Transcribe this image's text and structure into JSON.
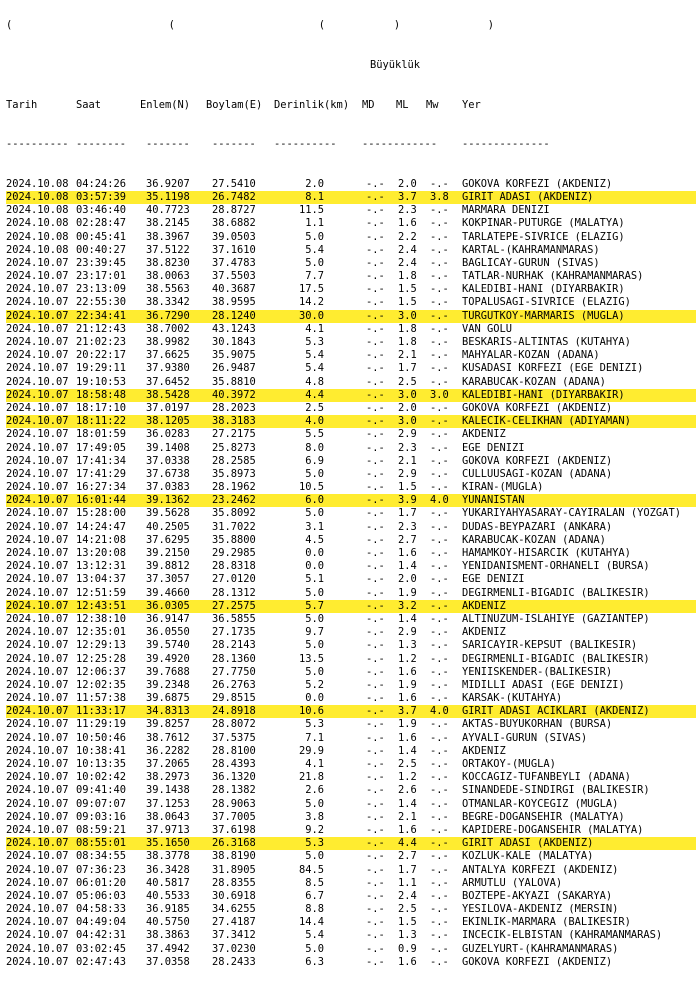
{
  "top_fragment": "(                         (                       (           )              )",
  "header": {
    "group_label": "Büyüklük",
    "columns": [
      "Tarih",
      "Saat",
      "Enlem(N)",
      "Boylam(E)",
      "Derinlik(km)",
      "MD",
      "ML",
      "Mw",
      "Yer"
    ]
  },
  "separator": [
    "----------",
    "--------",
    "-------",
    "-------",
    "----------",
    "------------",
    "--------------"
  ],
  "highlight_color": "#ffec30",
  "rows": [
    {
      "date": "2024.10.08",
      "time": "04:24:26",
      "lat": "36.9207",
      "lon": "27.5410",
      "depth": "2.0",
      "md": "-.-",
      "ml": "2.0",
      "mw": "-.-",
      "place": "GOKOVA KORFEZI (AKDENIZ)",
      "hl": false
    },
    {
      "date": "2024.10.08",
      "time": "03:57:39",
      "lat": "35.1198",
      "lon": "26.7482",
      "depth": "8.1",
      "md": "-.-",
      "ml": "3.7",
      "mw": "3.8",
      "place": "GIRIT ADASI (AKDENIZ)",
      "hl": true
    },
    {
      "date": "2024.10.08",
      "time": "03:46:40",
      "lat": "40.7723",
      "lon": "28.8727",
      "depth": "11.5",
      "md": "-.-",
      "ml": "2.3",
      "mw": "-.-",
      "place": "MARMARA DENIZI",
      "hl": false
    },
    {
      "date": "2024.10.08",
      "time": "02:28:47",
      "lat": "38.2145",
      "lon": "38.6882",
      "depth": "1.1",
      "md": "-.-",
      "ml": "1.6",
      "mw": "-.-",
      "place": "KOKPINAR-PUTURGE (MALATYA)",
      "hl": false
    },
    {
      "date": "2024.10.08",
      "time": "00:45:41",
      "lat": "38.3967",
      "lon": "39.0503",
      "depth": "5.0",
      "md": "-.-",
      "ml": "2.2",
      "mw": "-.-",
      "place": "TARLATEPE-SIVRICE (ELAZIG)",
      "hl": false
    },
    {
      "date": "2024.10.08",
      "time": "00:40:27",
      "lat": "37.5122",
      "lon": "37.1610",
      "depth": "5.4",
      "md": "-.-",
      "ml": "2.4",
      "mw": "-.-",
      "place": "KARTAL-(KAHRAMANMARAS)",
      "hl": false
    },
    {
      "date": "2024.10.07",
      "time": "23:39:45",
      "lat": "38.8230",
      "lon": "37.4783",
      "depth": "5.0",
      "md": "-.-",
      "ml": "2.4",
      "mw": "-.-",
      "place": "BAGLICAY-GURUN (SIVAS)",
      "hl": false
    },
    {
      "date": "2024.10.07",
      "time": "23:17:01",
      "lat": "38.0063",
      "lon": "37.5503",
      "depth": "7.7",
      "md": "-.-",
      "ml": "1.8",
      "mw": "-.-",
      "place": "TATLAR-NURHAK (KAHRAMANMARAS)",
      "hl": false
    },
    {
      "date": "2024.10.07",
      "time": "23:13:09",
      "lat": "38.5563",
      "lon": "40.3687",
      "depth": "17.5",
      "md": "-.-",
      "ml": "1.5",
      "mw": "-.-",
      "place": "KALEDIBI-HANI (DIYARBAKIR)",
      "hl": false
    },
    {
      "date": "2024.10.07",
      "time": "22:55:30",
      "lat": "38.3342",
      "lon": "38.9595",
      "depth": "14.2",
      "md": "-.-",
      "ml": "1.5",
      "mw": "-.-",
      "place": "TOPALUSAGI-SIVRICE (ELAZIG)",
      "hl": false
    },
    {
      "date": "2024.10.07",
      "time": "22:34:41",
      "lat": "36.7290",
      "lon": "28.1240",
      "depth": "30.0",
      "md": "-.-",
      "ml": "3.0",
      "mw": "-.-",
      "place": "TURGUTKOY-MARMARIS (MUGLA)",
      "hl": true
    },
    {
      "date": "2024.10.07",
      "time": "21:12:43",
      "lat": "38.7002",
      "lon": "43.1243",
      "depth": "4.1",
      "md": "-.-",
      "ml": "1.8",
      "mw": "-.-",
      "place": "VAN GOLU",
      "hl": false
    },
    {
      "date": "2024.10.07",
      "time": "21:02:23",
      "lat": "38.9982",
      "lon": "30.1843",
      "depth": "5.3",
      "md": "-.-",
      "ml": "1.8",
      "mw": "-.-",
      "place": "BESKARIS-ALTINTAS (KUTAHYA)",
      "hl": false
    },
    {
      "date": "2024.10.07",
      "time": "20:22:17",
      "lat": "37.6625",
      "lon": "35.9075",
      "depth": "5.4",
      "md": "-.-",
      "ml": "2.1",
      "mw": "-.-",
      "place": "MAHYALAR-KOZAN (ADANA)",
      "hl": false
    },
    {
      "date": "2024.10.07",
      "time": "19:29:11",
      "lat": "37.9380",
      "lon": "26.9487",
      "depth": "5.4",
      "md": "-.-",
      "ml": "1.7",
      "mw": "-.-",
      "place": "KUSADASI KORFEZI (EGE DENIZI)",
      "hl": false
    },
    {
      "date": "2024.10.07",
      "time": "19:10:53",
      "lat": "37.6452",
      "lon": "35.8810",
      "depth": "4.8",
      "md": "-.-",
      "ml": "2.5",
      "mw": "-.-",
      "place": "KARABUCAK-KOZAN (ADANA)",
      "hl": false
    },
    {
      "date": "2024.10.07",
      "time": "18:58:48",
      "lat": "38.5428",
      "lon": "40.3972",
      "depth": "4.4",
      "md": "-.-",
      "ml": "3.0",
      "mw": "3.0",
      "place": "KALEDIBI-HANI (DIYARBAKIR)",
      "hl": true
    },
    {
      "date": "2024.10.07",
      "time": "18:17:10",
      "lat": "37.0197",
      "lon": "28.2023",
      "depth": "2.5",
      "md": "-.-",
      "ml": "2.0",
      "mw": "-.-",
      "place": "GOKOVA KORFEZI (AKDENIZ)",
      "hl": false
    },
    {
      "date": "2024.10.07",
      "time": "18:11:22",
      "lat": "38.1205",
      "lon": "38.3183",
      "depth": "4.0",
      "md": "-.-",
      "ml": "3.0",
      "mw": "-.-",
      "place": "KALECIK-CELIKHAN (ADIYAMAN)",
      "hl": true
    },
    {
      "date": "2024.10.07",
      "time": "18:01:59",
      "lat": "36.0283",
      "lon": "27.2175",
      "depth": "5.5",
      "md": "-.-",
      "ml": "2.9",
      "mw": "-.-",
      "place": "AKDENIZ",
      "hl": false
    },
    {
      "date": "2024.10.07",
      "time": "17:49:05",
      "lat": "39.1408",
      "lon": "25.8273",
      "depth": "8.0",
      "md": "-.-",
      "ml": "2.3",
      "mw": "-.-",
      "place": "EGE DENIZI",
      "hl": false
    },
    {
      "date": "2024.10.07",
      "time": "17:41:34",
      "lat": "37.0338",
      "lon": "28.2585",
      "depth": "6.9",
      "md": "-.-",
      "ml": "2.1",
      "mw": "-.-",
      "place": "GOKOVA KORFEZI (AKDENIZ)",
      "hl": false
    },
    {
      "date": "2024.10.07",
      "time": "17:41:29",
      "lat": "37.6738",
      "lon": "35.8973",
      "depth": "5.0",
      "md": "-.-",
      "ml": "2.9",
      "mw": "-.-",
      "place": "CULLUUSAGI-KOZAN (ADANA)",
      "hl": false
    },
    {
      "date": "2024.10.07",
      "time": "16:27:34",
      "lat": "37.0383",
      "lon": "28.1962",
      "depth": "10.5",
      "md": "-.-",
      "ml": "1.5",
      "mw": "-.-",
      "place": "KIRAN-(MUGLA)",
      "hl": false
    },
    {
      "date": "2024.10.07",
      "time": "16:01:44",
      "lat": "39.1362",
      "lon": "23.2462",
      "depth": "6.0",
      "md": "-.-",
      "ml": "3.9",
      "mw": "4.0",
      "place": "YUNANISTAN",
      "hl": true
    },
    {
      "date": "2024.10.07",
      "time": "15:28:00",
      "lat": "39.5628",
      "lon": "35.8092",
      "depth": "5.0",
      "md": "-.-",
      "ml": "1.7",
      "mw": "-.-",
      "place": "YUKARIYAHYASARAY-CAYIRALAN (YOZGAT)",
      "hl": false
    },
    {
      "date": "2024.10.07",
      "time": "14:24:47",
      "lat": "40.2505",
      "lon": "31.7022",
      "depth": "3.1",
      "md": "-.-",
      "ml": "2.3",
      "mw": "-.-",
      "place": "DUDAS-BEYPAZARI (ANKARA)",
      "hl": false
    },
    {
      "date": "2024.10.07",
      "time": "14:21:08",
      "lat": "37.6295",
      "lon": "35.8800",
      "depth": "4.5",
      "md": "-.-",
      "ml": "2.7",
      "mw": "-.-",
      "place": "KARABUCAK-KOZAN (ADANA)",
      "hl": false
    },
    {
      "date": "2024.10.07",
      "time": "13:20:08",
      "lat": "39.2150",
      "lon": "29.2985",
      "depth": "0.0",
      "md": "-.-",
      "ml": "1.6",
      "mw": "-.-",
      "place": "HAMAMKOY-HISARCIK (KUTAHYA)",
      "hl": false
    },
    {
      "date": "2024.10.07",
      "time": "13:12:31",
      "lat": "39.8812",
      "lon": "28.8318",
      "depth": "0.0",
      "md": "-.-",
      "ml": "1.4",
      "mw": "-.-",
      "place": "YENIDANISMENT-ORHANELI (BURSA)",
      "hl": false
    },
    {
      "date": "2024.10.07",
      "time": "13:04:37",
      "lat": "37.3057",
      "lon": "27.0120",
      "depth": "5.1",
      "md": "-.-",
      "ml": "2.0",
      "mw": "-.-",
      "place": "EGE DENIZI",
      "hl": false
    },
    {
      "date": "2024.10.07",
      "time": "12:51:59",
      "lat": "39.4660",
      "lon": "28.1312",
      "depth": "5.0",
      "md": "-.-",
      "ml": "1.9",
      "mw": "-.-",
      "place": "DEGIRMENLI-BIGADIC (BALIKESIR)",
      "hl": false
    },
    {
      "date": "2024.10.07",
      "time": "12:43:51",
      "lat": "36.0305",
      "lon": "27.2575",
      "depth": "5.7",
      "md": "-.-",
      "ml": "3.2",
      "mw": "-.-",
      "place": "AKDENIZ",
      "hl": true
    },
    {
      "date": "2024.10.07",
      "time": "12:38:10",
      "lat": "36.9147",
      "lon": "36.5855",
      "depth": "5.0",
      "md": "-.-",
      "ml": "1.4",
      "mw": "-.-",
      "place": "ALTINUZUM-ISLAHIYE (GAZIANTEP)",
      "hl": false
    },
    {
      "date": "2024.10.07",
      "time": "12:35:01",
      "lat": "36.0550",
      "lon": "27.1735",
      "depth": "9.7",
      "md": "-.-",
      "ml": "2.9",
      "mw": "-.-",
      "place": "AKDENIZ",
      "hl": false
    },
    {
      "date": "2024.10.07",
      "time": "12:29:13",
      "lat": "39.5740",
      "lon": "28.2143",
      "depth": "5.0",
      "md": "-.-",
      "ml": "1.3",
      "mw": "-.-",
      "place": "SARICAYIR-KEPSUT (BALIKESIR)",
      "hl": false
    },
    {
      "date": "2024.10.07",
      "time": "12:25:28",
      "lat": "39.4920",
      "lon": "28.1360",
      "depth": "13.5",
      "md": "-.-",
      "ml": "1.2",
      "mw": "-.-",
      "place": "DEGIRMENLI-BIGADIC (BALIKESIR)",
      "hl": false
    },
    {
      "date": "2024.10.07",
      "time": "12:06:37",
      "lat": "39.7688",
      "lon": "27.7750",
      "depth": "5.0",
      "md": "-.-",
      "ml": "1.6",
      "mw": "-.-",
      "place": "YENIISKENDER-(BALIKESIR)",
      "hl": false
    },
    {
      "date": "2024.10.07",
      "time": "12:02:35",
      "lat": "39.2348",
      "lon": "26.2763",
      "depth": "5.2",
      "md": "-.-",
      "ml": "1.9",
      "mw": "-.-",
      "place": "MIDILLI ADASI (EGE DENIZI)",
      "hl": false
    },
    {
      "date": "2024.10.07",
      "time": "11:57:38",
      "lat": "39.6875",
      "lon": "29.8515",
      "depth": "0.0",
      "md": "-.-",
      "ml": "1.6",
      "mw": "-.-",
      "place": "KARSAK-(KUTAHYA)",
      "hl": false
    },
    {
      "date": "2024.10.07",
      "time": "11:33:17",
      "lat": "34.8313",
      "lon": "24.8918",
      "depth": "10.6",
      "md": "-.-",
      "ml": "3.7",
      "mw": "4.0",
      "place": "GIRIT ADASI ACIKLARI (AKDENIZ)",
      "hl": true
    },
    {
      "date": "2024.10.07",
      "time": "11:29:19",
      "lat": "39.8257",
      "lon": "28.8072",
      "depth": "5.3",
      "md": "-.-",
      "ml": "1.9",
      "mw": "-.-",
      "place": "AKTAS-BUYUKORHAN (BURSA)",
      "hl": false
    },
    {
      "date": "2024.10.07",
      "time": "10:50:46",
      "lat": "38.7612",
      "lon": "37.5375",
      "depth": "7.1",
      "md": "-.-",
      "ml": "1.6",
      "mw": "-.-",
      "place": "AYVALI-GURUN (SIVAS)",
      "hl": false
    },
    {
      "date": "2024.10.07",
      "time": "10:38:41",
      "lat": "36.2282",
      "lon": "28.8100",
      "depth": "29.9",
      "md": "-.-",
      "ml": "1.4",
      "mw": "-.-",
      "place": "AKDENIZ",
      "hl": false
    },
    {
      "date": "2024.10.07",
      "time": "10:13:35",
      "lat": "37.2065",
      "lon": "28.4393",
      "depth": "4.1",
      "md": "-.-",
      "ml": "2.5",
      "mw": "-.-",
      "place": "ORTAKOY-(MUGLA)",
      "hl": false
    },
    {
      "date": "2024.10.07",
      "time": "10:02:42",
      "lat": "38.2973",
      "lon": "36.1320",
      "depth": "21.8",
      "md": "-.-",
      "ml": "1.2",
      "mw": "-.-",
      "place": "KOCCAGIZ-TUFANBEYLI (ADANA)",
      "hl": false
    },
    {
      "date": "2024.10.07",
      "time": "09:41:40",
      "lat": "39.1438",
      "lon": "28.1382",
      "depth": "2.6",
      "md": "-.-",
      "ml": "2.6",
      "mw": "-.-",
      "place": "SINANDEDE-SINDIRGI (BALIKESIR)",
      "hl": false
    },
    {
      "date": "2024.10.07",
      "time": "09:07:07",
      "lat": "37.1253",
      "lon": "28.9063",
      "depth": "5.0",
      "md": "-.-",
      "ml": "1.4",
      "mw": "-.-",
      "place": "OTMANLAR-KOYCEGIZ (MUGLA)",
      "hl": false
    },
    {
      "date": "2024.10.07",
      "time": "09:03:16",
      "lat": "38.0643",
      "lon": "37.7005",
      "depth": "3.8",
      "md": "-.-",
      "ml": "2.1",
      "mw": "-.-",
      "place": "BEGRE-DOGANSEHIR (MALATYA)",
      "hl": false
    },
    {
      "date": "2024.10.07",
      "time": "08:59:21",
      "lat": "37.9713",
      "lon": "37.6198",
      "depth": "9.2",
      "md": "-.-",
      "ml": "1.6",
      "mw": "-.-",
      "place": "KAPIDERE-DOGANSEHIR (MALATYA)",
      "hl": false
    },
    {
      "date": "2024.10.07",
      "time": "08:55:01",
      "lat": "35.1650",
      "lon": "26.3168",
      "depth": "5.3",
      "md": "-.-",
      "ml": "4.4",
      "mw": "-.-",
      "place": "GIRIT ADASI (AKDENIZ)",
      "hl": true
    },
    {
      "date": "2024.10.07",
      "time": "08:34:55",
      "lat": "38.3778",
      "lon": "38.8190",
      "depth": "5.0",
      "md": "-.-",
      "ml": "2.7",
      "mw": "-.-",
      "place": "KOZLUK-KALE (MALATYA)",
      "hl": false
    },
    {
      "date": "2024.10.07",
      "time": "07:36:23",
      "lat": "36.3428",
      "lon": "31.8905",
      "depth": "84.5",
      "md": "-.-",
      "ml": "1.7",
      "mw": "-.-",
      "place": "ANTALYA KORFEZI (AKDENIZ)",
      "hl": false
    },
    {
      "date": "2024.10.07",
      "time": "06:01:20",
      "lat": "40.5817",
      "lon": "28.8355",
      "depth": "8.5",
      "md": "-.-",
      "ml": "1.1",
      "mw": "-.-",
      "place": "ARMUTLU (YALOVA)",
      "hl": false
    },
    {
      "date": "2024.10.07",
      "time": "05:06:03",
      "lat": "40.5533",
      "lon": "30.6918",
      "depth": "6.7",
      "md": "-.-",
      "ml": "2.4",
      "mw": "-.-",
      "place": "BOZTEPE-AKYAZI (SAKARYA)",
      "hl": false
    },
    {
      "date": "2024.10.07",
      "time": "04:58:33",
      "lat": "36.9185",
      "lon": "34.6255",
      "depth": "8.8",
      "md": "-.-",
      "ml": "2.5",
      "mw": "-.-",
      "place": "YESILOVA-AKDENIZ (MERSIN)",
      "hl": false
    },
    {
      "date": "2024.10.07",
      "time": "04:49:04",
      "lat": "40.5750",
      "lon": "27.4187",
      "depth": "14.4",
      "md": "-.-",
      "ml": "1.5",
      "mw": "-.-",
      "place": "EKINLIK-MARMARA (BALIKESIR)",
      "hl": false
    },
    {
      "date": "2024.10.07",
      "time": "04:42:31",
      "lat": "38.3863",
      "lon": "37.3412",
      "depth": "5.4",
      "md": "-.-",
      "ml": "1.3",
      "mw": "-.-",
      "place": "INCECIK-ELBISTAN (KAHRAMANMARAS)",
      "hl": false
    },
    {
      "date": "2024.10.07",
      "time": "03:02:45",
      "lat": "37.4942",
      "lon": "37.0230",
      "depth": "5.0",
      "md": "-.-",
      "ml": "0.9",
      "mw": "-.-",
      "place": "GUZELYURT-(KAHRAMANMARAS)",
      "hl": false
    },
    {
      "date": "2024.10.07",
      "time": "02:47:43",
      "lat": "37.0358",
      "lon": "28.2433",
      "depth": "6.3",
      "md": "-.-",
      "ml": "1.6",
      "mw": "-.-",
      "place": "GOKOVA KORFEZI (AKDENIZ)",
      "hl": false
    }
  ]
}
